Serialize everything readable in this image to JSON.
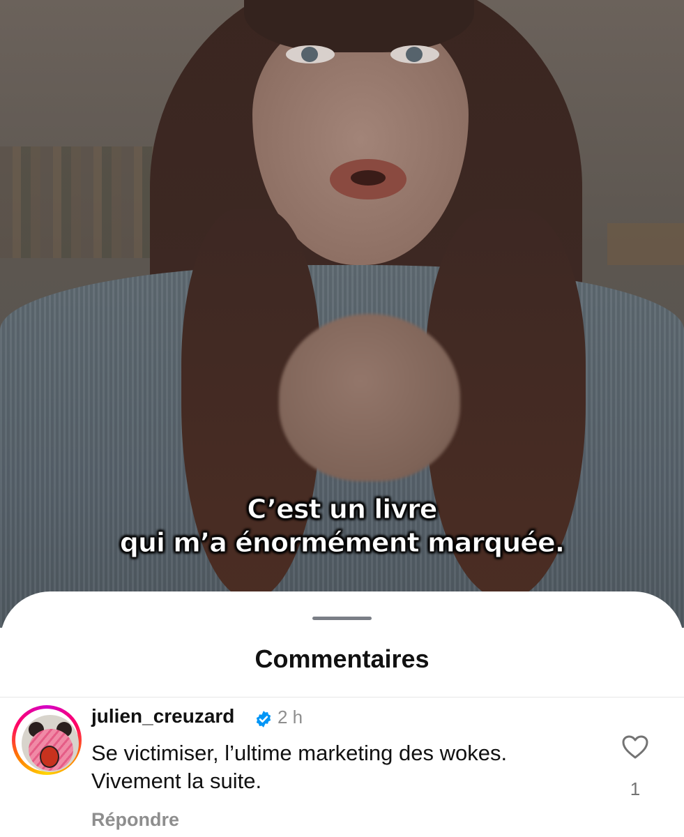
{
  "video": {
    "subtitle_line1": "C’est un livre",
    "subtitle_line2": "qui m’a énormément marquée."
  },
  "sheet": {
    "title": "Commentaires"
  },
  "comments": [
    {
      "username": "julien_creuzard",
      "verified": true,
      "time": "2 h",
      "text_line1": "Se victimiser, l’ultime marketing des wokes.",
      "text_line2": "Vivement la suite.",
      "reply_label": "Répondre",
      "like_count": "1",
      "icons": {
        "verified": "verified-badge-icon",
        "like": "heart-outline-icon"
      }
    }
  ],
  "colors": {
    "verified_blue": "#0095f6",
    "story_ring": [
      "#d300c5",
      "#ff0069",
      "#ff7a00",
      "#ffd600"
    ],
    "secondary_text": "#8e8e8e"
  }
}
